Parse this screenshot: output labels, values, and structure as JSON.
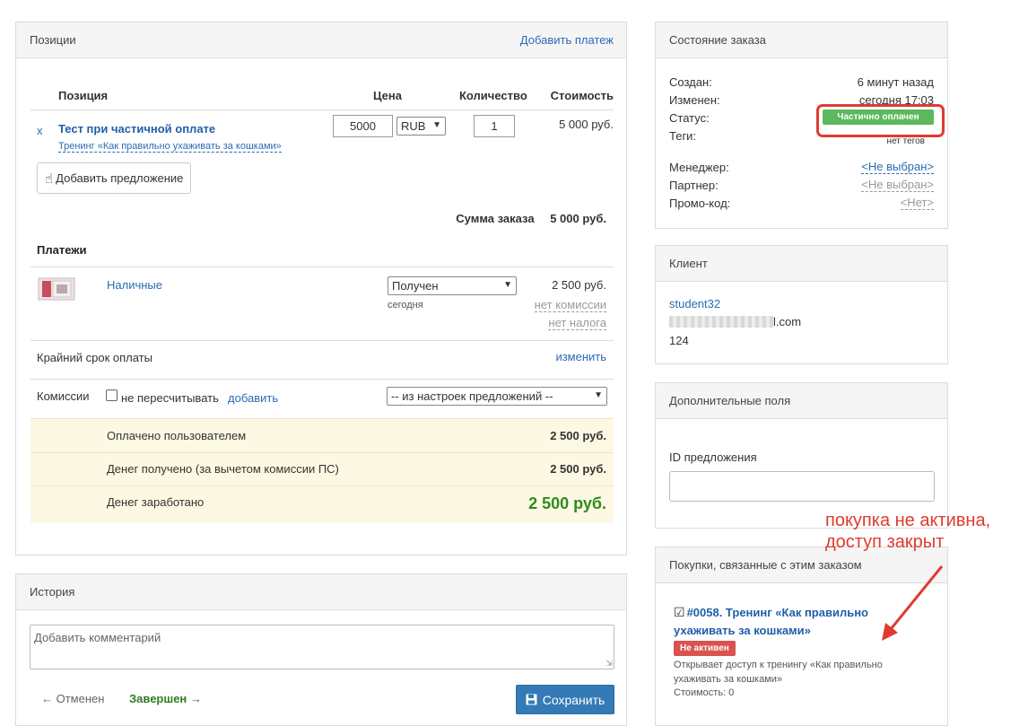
{
  "positions": {
    "title": "Позиции",
    "add_payment": "Добавить платеж",
    "columns": {
      "item": "Позиция",
      "price": "Цена",
      "qty": "Количество",
      "cost": "Стоимость"
    },
    "item": {
      "remove": "x",
      "title": "Тест при частичной оплате",
      "subtitle": "Тренинг «Как правильно ухаживать за кошками»",
      "price": "5000",
      "currency": "RUB",
      "qty": "1",
      "cost": "5 000 руб."
    },
    "add_offer": "Добавить предложение",
    "sum_label": "Сумма заказа",
    "sum_value": "5 000 руб.",
    "payments_title": "Платежи",
    "payment": {
      "method": "Наличные",
      "status": "Получен",
      "date": "сегодня",
      "amount": "2 500 руб.",
      "no_commission": "нет комиссии",
      "no_tax": "нет налога"
    },
    "deadline_label": "Крайний срок оплаты",
    "deadline_change": "изменить",
    "commission_label": "Комиссии",
    "no_recalc": "не пересчитывать",
    "add_link": "добавить",
    "commission_select": "-- из настроек предложений --",
    "paid_by_user_label": "Оплачено пользователем",
    "paid_by_user_value": "2 500 руб.",
    "received_label": "Денег получено (за вычетом комиссии ПС)",
    "received_value": "2 500 руб.",
    "earned_label": "Денег заработано",
    "earned_value": "2 500 руб."
  },
  "history": {
    "title": "История",
    "comment_placeholder": "Добавить комментарий",
    "cancelled": "← Отменен",
    "completed": "Завершен →",
    "save": "Сохранить"
  },
  "order_status": {
    "title": "Состояние заказа",
    "created_label": "Создан:",
    "created_value": "6 минут назад",
    "modified_label": "Изменен:",
    "modified_value": "сегодня 17:03",
    "status_label": "Статус:",
    "status_value": "Частично оплачен",
    "tags_label": "Теги:",
    "tags_value": "нет тегов",
    "manager_label": "Менеджер:",
    "manager_value": "<Не выбран>",
    "partner_label": "Партнер:",
    "partner_value": "<Не выбран>",
    "promo_label": "Промо-код:",
    "promo_value": "<Нет>"
  },
  "client": {
    "title": "Клиент",
    "name": "student32",
    "email_suffix": "l.com",
    "phone": "124"
  },
  "extra_fields": {
    "title": "Дополнительные поля",
    "offer_id_label": "ID предложения"
  },
  "purchases": {
    "title": "Покупки, связанные с этим заказом",
    "item_title": "#0058. Тренинг «Как правильно ухаживать за кошками»",
    "badge": "Не активен",
    "description": "Открывает доступ к тренингу «Как правильно ухаживать за кошками»",
    "cost": "Стоимость: 0"
  },
  "annotation": {
    "line1": "покупка не активна,",
    "line2": "доступ закрыт"
  },
  "colors": {
    "accent": "#2a6bb5",
    "status_green": "#5cb85c",
    "inactive_red": "#d9534f",
    "annotation_red": "#e03a2f",
    "earned_green": "#2e8b1e"
  }
}
